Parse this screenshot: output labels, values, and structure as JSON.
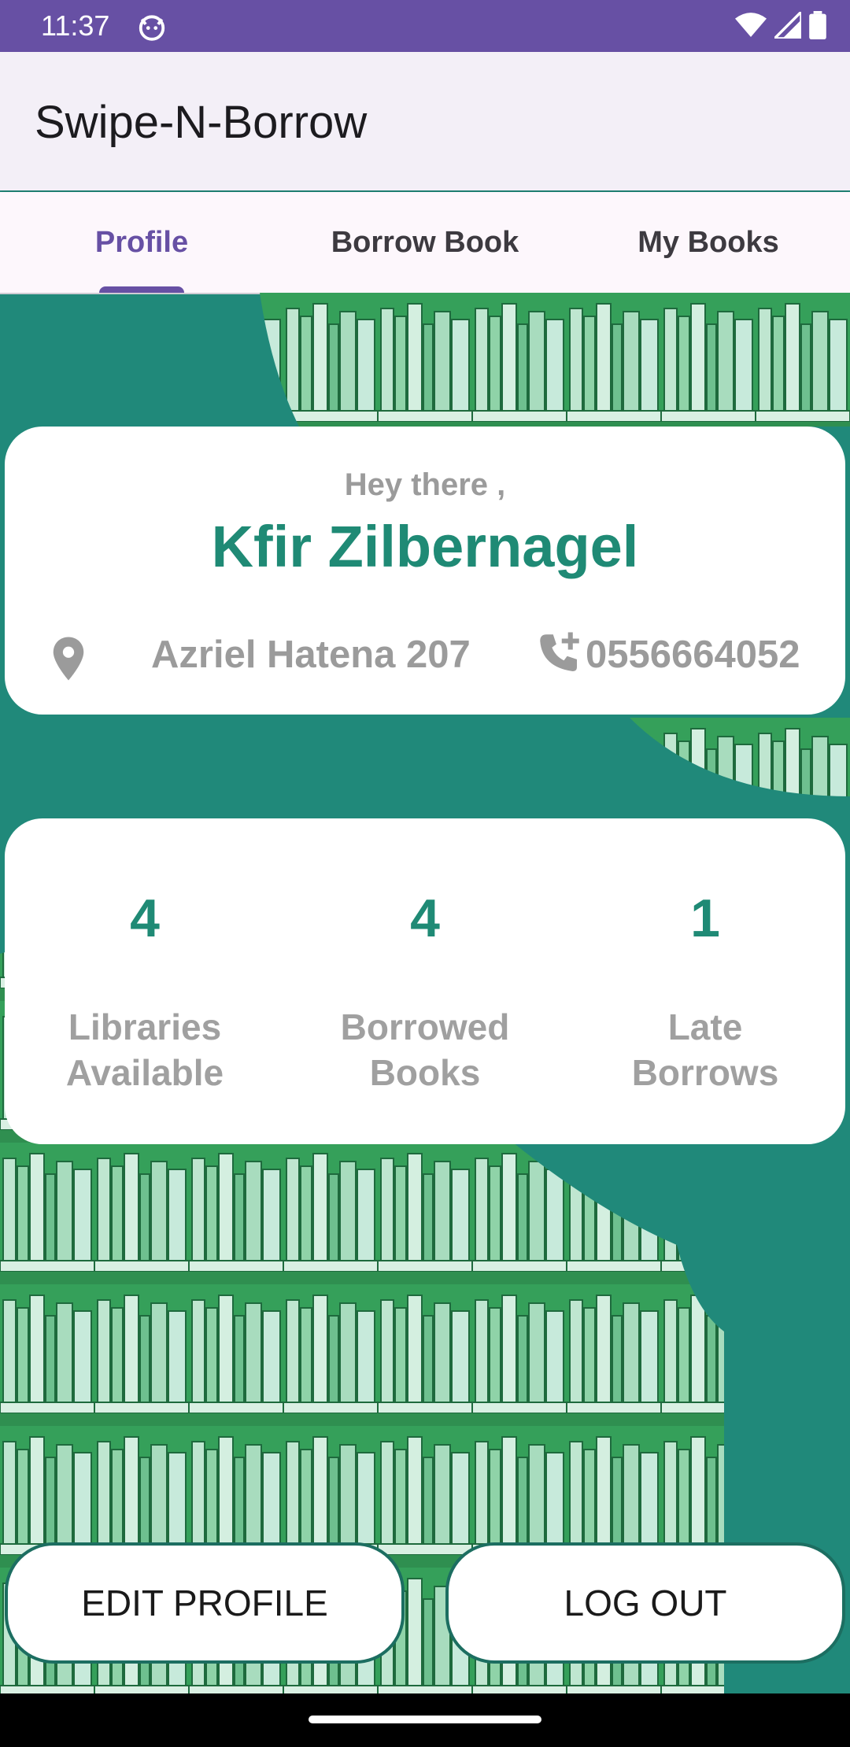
{
  "status_bar": {
    "time": "11:37",
    "icons": [
      "cat-notification-icon",
      "wifi-icon",
      "cell-signal-icon",
      "battery-icon"
    ]
  },
  "app_bar": {
    "title": "Swipe-N-Borrow"
  },
  "tabs": [
    {
      "label": "Profile",
      "active": true
    },
    {
      "label": "Borrow Book",
      "active": false
    },
    {
      "label": "My Books",
      "active": false
    }
  ],
  "profile": {
    "greeting": "Hey there ,",
    "name": "Kfir Zilbernagel",
    "address": "Azriel Hatena 207",
    "phone": "0556664052",
    "icons": {
      "address": "location-pin-icon",
      "phone": "phone-add-icon"
    }
  },
  "stats": [
    {
      "value": "4",
      "label_line1": "Libraries",
      "label_line2": "Available"
    },
    {
      "value": "4",
      "label_line1": "Borrowed",
      "label_line2": "Books"
    },
    {
      "value": "1",
      "label_line1": "Late",
      "label_line2": "Borrows"
    }
  ],
  "buttons": {
    "edit_profile": "EDIT PROFILE",
    "log_out": "LOG OUT"
  },
  "colors": {
    "primary": "#6750a4",
    "background_teal": "#20897a",
    "accent_text": "#1f8a75",
    "muted_text": "#9b9b9b",
    "bookshelf_green": "#35a05a"
  }
}
